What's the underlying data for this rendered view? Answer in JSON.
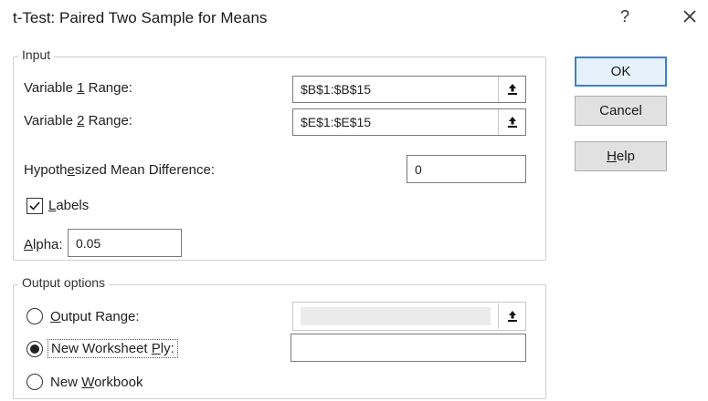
{
  "dialog": {
    "title": "t-Test: Paired Two Sample for Means",
    "help_glyph": "?",
    "close_icon": "close-icon"
  },
  "input": {
    "legend": "Input",
    "var1": {
      "label_pre": "Variable ",
      "label_u": "1",
      "label_post": " Range:",
      "value": "$B$1:$B$15"
    },
    "var2": {
      "label_pre": "Variable ",
      "label_u": "2",
      "label_post": " Range:",
      "value": "$E$1:$E$15"
    },
    "hypo": {
      "label_pre": "Hypoth",
      "label_u": "e",
      "label_post": "sized Mean Difference:",
      "value": "0"
    },
    "labels": {
      "label_u": "L",
      "label_post": "abels",
      "checked": true
    },
    "alpha": {
      "label_u": "A",
      "label_post": "lpha:",
      "value": "0.05"
    }
  },
  "output": {
    "legend": "Output options",
    "output_range": {
      "label_u": "O",
      "label_post": "utput Range:",
      "selected": false,
      "value": ""
    },
    "new_sheet": {
      "label_pre": "New Worksheet ",
      "label_u": "P",
      "label_post": "ly:",
      "selected": true,
      "value": ""
    },
    "new_workbook": {
      "label_pre": "New ",
      "label_u": "W",
      "label_post": "orkbook",
      "selected": false
    }
  },
  "buttons": {
    "ok": "OK",
    "cancel": "Cancel",
    "help_u": "H",
    "help_post": "elp"
  },
  "colors": {
    "accent": "#3c7fd1",
    "button_bg": "#e1e1e1",
    "default_button_bg": "#e5f1fb"
  }
}
